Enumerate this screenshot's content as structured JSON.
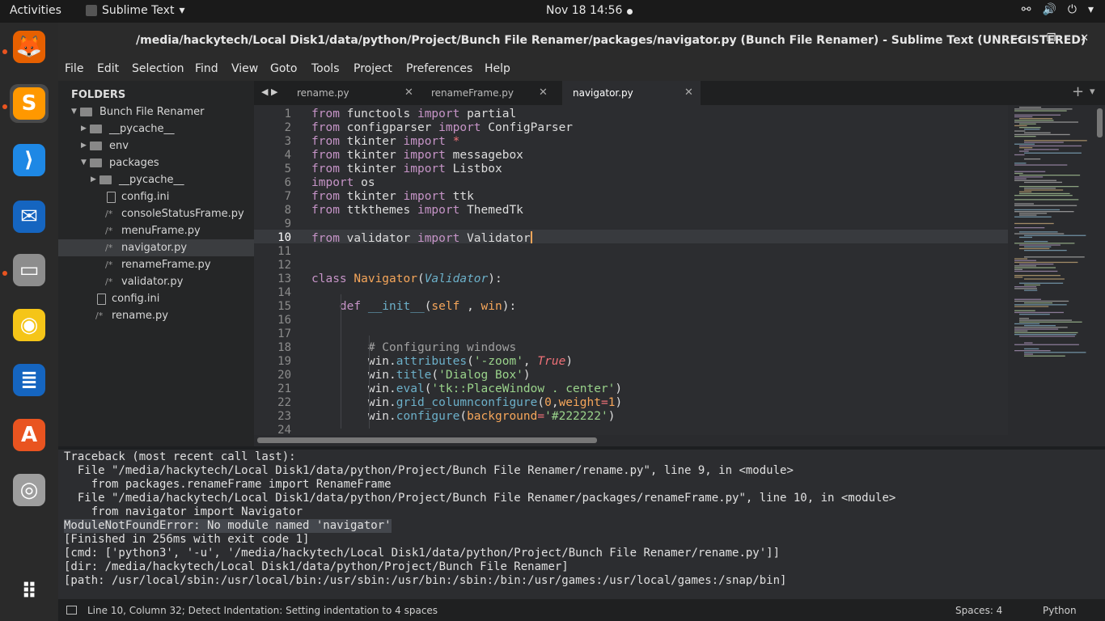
{
  "topbar": {
    "activities": "Activities",
    "app": "Sublime Text",
    "app_caret": "▾",
    "clock": "Nov 18  14:56",
    "tray": [
      "⚯",
      "🔊",
      "⏻",
      "▾"
    ]
  },
  "dock": [
    {
      "name": "firefox-icon",
      "glyph": "🦊",
      "bg": "#e66000"
    },
    {
      "name": "sublime-text-icon",
      "glyph": "S",
      "bg": "#ff9800"
    },
    {
      "name": "vscode-icon",
      "glyph": "⟩",
      "bg": "#1e88e5"
    },
    {
      "name": "thunderbird-icon",
      "glyph": "✉",
      "bg": "#1565c0"
    },
    {
      "name": "files-icon",
      "glyph": "▭",
      "bg": "#8d8d8d"
    },
    {
      "name": "rhythmbox-icon",
      "glyph": "◉",
      "bg": "#f5c518"
    },
    {
      "name": "writer-icon",
      "glyph": "≣",
      "bg": "#1565c0"
    },
    {
      "name": "software-icon",
      "glyph": "A",
      "bg": "#e95420"
    },
    {
      "name": "disc-icon",
      "glyph": "◎",
      "bg": "#9e9e9e"
    },
    {
      "name": "app-grid-icon",
      "glyph": "⠿",
      "bg": "transparent"
    }
  ],
  "window": {
    "title": "/media/hackytech/Local Disk1/data/python/Project/Bunch File Renamer/packages/navigator.py (Bunch File Renamer) - Sublime Text (UNREGISTERED)",
    "controls": [
      "—",
      "❐",
      "✕"
    ]
  },
  "menu": [
    "File",
    "Edit",
    "Selection",
    "Find",
    "View",
    "Goto",
    "Tools",
    "Project",
    "Preferences",
    "Help"
  ],
  "sidebar": {
    "header": "FOLDERS",
    "items": [
      {
        "label": "Bunch File Renamer",
        "type": "folder-open",
        "depth": 0
      },
      {
        "label": "__pycache__",
        "type": "folder",
        "depth": 1
      },
      {
        "label": "env",
        "type": "folder",
        "depth": 1
      },
      {
        "label": "packages",
        "type": "folder-open",
        "depth": 1
      },
      {
        "label": "__pycache__",
        "type": "folder",
        "depth": 2
      },
      {
        "label": "config.ini",
        "type": "file",
        "depth": 2
      },
      {
        "label": "consoleStatusFrame.py",
        "type": "py",
        "depth": 2
      },
      {
        "label": "menuFrame.py",
        "type": "py",
        "depth": 2
      },
      {
        "label": "navigator.py",
        "type": "py",
        "depth": 2,
        "selected": true
      },
      {
        "label": "renameFrame.py",
        "type": "py",
        "depth": 2
      },
      {
        "label": "validator.py",
        "type": "py",
        "depth": 2
      },
      {
        "label": "config.ini",
        "type": "file",
        "depth": 1
      },
      {
        "label": "rename.py",
        "type": "py",
        "depth": 1
      }
    ]
  },
  "tabs": [
    {
      "label": "rename.py"
    },
    {
      "label": "renameFrame.py"
    },
    {
      "label": "navigator.py",
      "active": true
    }
  ],
  "tab_nav": "◀ ▶",
  "tab_plus": "+",
  "tab_more": "▾",
  "code_lines": [
    [
      [
        "kw",
        "from "
      ],
      [
        "",
        "functools "
      ],
      [
        "kw",
        "import "
      ],
      [
        "",
        "partial"
      ]
    ],
    [
      [
        "kw",
        "from "
      ],
      [
        "",
        "configparser "
      ],
      [
        "kw",
        "import "
      ],
      [
        "",
        "ConfigParser"
      ]
    ],
    [
      [
        "kw",
        "from "
      ],
      [
        "",
        "tkinter "
      ],
      [
        "kw",
        "import "
      ],
      [
        "op",
        "*"
      ]
    ],
    [
      [
        "kw",
        "from "
      ],
      [
        "",
        "tkinter "
      ],
      [
        "kw",
        "import "
      ],
      [
        "",
        "messagebox"
      ]
    ],
    [
      [
        "kw",
        "from "
      ],
      [
        "",
        "tkinter "
      ],
      [
        "kw",
        "import "
      ],
      [
        "",
        "Listbox"
      ]
    ],
    [
      [
        "kw",
        "import "
      ],
      [
        "",
        "os"
      ]
    ],
    [
      [
        "kw",
        "from "
      ],
      [
        "",
        "tkinter "
      ],
      [
        "kw",
        "import "
      ],
      [
        "",
        "ttk"
      ]
    ],
    [
      [
        "kw",
        "from "
      ],
      [
        "",
        "ttkthemes "
      ],
      [
        "kw",
        "import "
      ],
      [
        "",
        "ThemedTk"
      ]
    ],
    [],
    [
      [
        "kw",
        "from "
      ],
      [
        "",
        "validator "
      ],
      [
        "kw",
        "import "
      ],
      [
        "",
        "Validator"
      ]
    ],
    [],
    [],
    [
      [
        "kw",
        "class "
      ],
      [
        "cls",
        "Navigator"
      ],
      [
        "",
        "("
      ],
      [
        "it",
        "Validator"
      ],
      [
        "",
        "):"
      ]
    ],
    [],
    [
      [
        "",
        "    "
      ],
      [
        "kw",
        "def "
      ],
      [
        "fn",
        "__init__"
      ],
      [
        "",
        "("
      ],
      [
        "sf",
        "self"
      ],
      [
        "",
        " , "
      ],
      [
        "sf",
        "win"
      ],
      [
        "",
        "):"
      ]
    ],
    [],
    [],
    [
      [
        "",
        "        "
      ],
      [
        "cm",
        "# Configuring windows"
      ]
    ],
    [
      [
        "",
        "        win."
      ],
      [
        "fn",
        "attributes"
      ],
      [
        "",
        "("
      ],
      [
        "str",
        "'-zoom'"
      ],
      [
        "",
        ", "
      ],
      [
        "bool",
        "True"
      ],
      [
        "",
        ")"
      ]
    ],
    [
      [
        "",
        "        win."
      ],
      [
        "fn",
        "title"
      ],
      [
        "",
        "("
      ],
      [
        "str",
        "'Dialog Box'"
      ],
      [
        "",
        ")"
      ]
    ],
    [
      [
        "",
        "        win."
      ],
      [
        "fn",
        "eval"
      ],
      [
        "",
        "("
      ],
      [
        "str",
        "'tk::PlaceWindow . center'"
      ],
      [
        "",
        ")"
      ]
    ],
    [
      [
        "",
        "        win."
      ],
      [
        "fn",
        "grid_columnconfigure"
      ],
      [
        "",
        "("
      ],
      [
        "sf",
        "0"
      ],
      [
        "",
        ","
      ],
      [
        "sf",
        "weight"
      ],
      [
        "op",
        "="
      ],
      [
        "sf",
        "1"
      ],
      [
        "",
        ")"
      ]
    ],
    [
      [
        "",
        "        win."
      ],
      [
        "fn",
        "configure"
      ],
      [
        "",
        "("
      ],
      [
        "sf",
        "background"
      ],
      [
        "op",
        "="
      ],
      [
        "str",
        "'#222222'"
      ],
      [
        "",
        ")"
      ]
    ],
    []
  ],
  "line_numbers": [
    "1",
    "2",
    "3",
    "4",
    "5",
    "6",
    "7",
    "8",
    "9",
    "10",
    "11",
    "12",
    "13",
    "14",
    "15",
    "16",
    "17",
    "18",
    "19",
    "20",
    "21",
    "22",
    "23",
    "24"
  ],
  "console": [
    "Traceback (most recent call last):",
    "  File \"/media/hackytech/Local Disk1/data/python/Project/Bunch File Renamer/rename.py\", line 9, in <module>",
    "    from packages.renameFrame import RenameFrame",
    "  File \"/media/hackytech/Local Disk1/data/python/Project/Bunch File Renamer/packages/renameFrame.py\", line 10, in <module>",
    "    from navigator import Navigator",
    "ModuleNotFoundError: No module named 'navigator'",
    "[Finished in 256ms with exit code 1]",
    "[cmd: ['python3', '-u', '/media/hackytech/Local Disk1/data/python/Project/Bunch File Renamer/rename.py']]",
    "[dir: /media/hackytech/Local Disk1/data/python/Project/Bunch File Renamer]",
    "[path: /usr/local/sbin:/usr/local/bin:/usr/sbin:/usr/bin:/sbin:/bin:/usr/games:/usr/local/games:/snap/bin]"
  ],
  "status": {
    "message": "Line 10, Column 32; Detect Indentation: Setting indentation to 4 spaces",
    "spaces": "Spaces: 4",
    "language": "Python"
  }
}
